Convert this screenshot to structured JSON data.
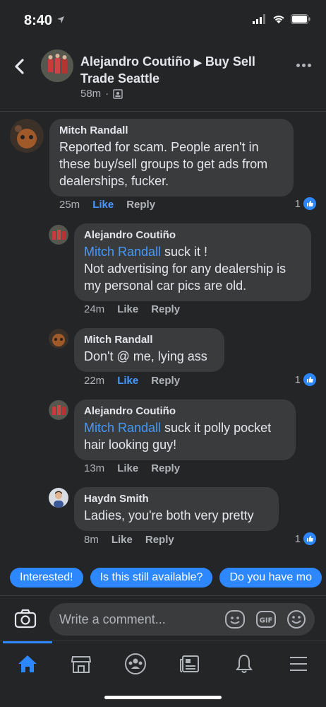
{
  "status": {
    "time": "8:40"
  },
  "header": {
    "author": "Alejandro Coutiño",
    "arrow": "▶",
    "group": "Buy Sell Trade Seattle",
    "time": "58m",
    "privacy_icon": "group-icon"
  },
  "comments": [
    {
      "author": "Mitch Randall",
      "mention": "",
      "text": "Reported for scam. People aren't in these buy/sell groups to get ads from dealerships, fucker.",
      "time": "25m",
      "like": "Like",
      "reply": "Reply",
      "likes": "1",
      "liked": true
    },
    {
      "author": "Alejandro Coutiño",
      "mention": "Mitch Randall",
      "text": " suck it !\nNot advertising for any dealership is my personal car pics are old.",
      "time": "24m",
      "like": "Like",
      "reply": "Reply",
      "likes": "",
      "liked": false
    },
    {
      "author": "Mitch Randall",
      "mention": "",
      "text": "Don't @ me, lying ass",
      "time": "22m",
      "like": "Like",
      "reply": "Reply",
      "likes": "1",
      "liked": true
    },
    {
      "author": "Alejandro Coutiño",
      "mention": "Mitch Randall",
      "text": " suck it polly pocket hair looking guy!",
      "time": "13m",
      "like": "Like",
      "reply": "Reply",
      "likes": "",
      "liked": false
    },
    {
      "author": "Haydn Smith",
      "mention": "",
      "text": "Ladies, you're both very pretty",
      "time": "8m",
      "like": "Like",
      "reply": "Reply",
      "likes": "1",
      "liked": false
    }
  ],
  "chips": [
    "Interested!",
    "Is this still available?",
    "Do you have mo"
  ],
  "composer": {
    "placeholder": "Write a comment..."
  },
  "colors": {
    "background": "#242526",
    "bubble": "#3a3b3c",
    "accent": "#2d88ff",
    "mention": "#4599ff"
  }
}
